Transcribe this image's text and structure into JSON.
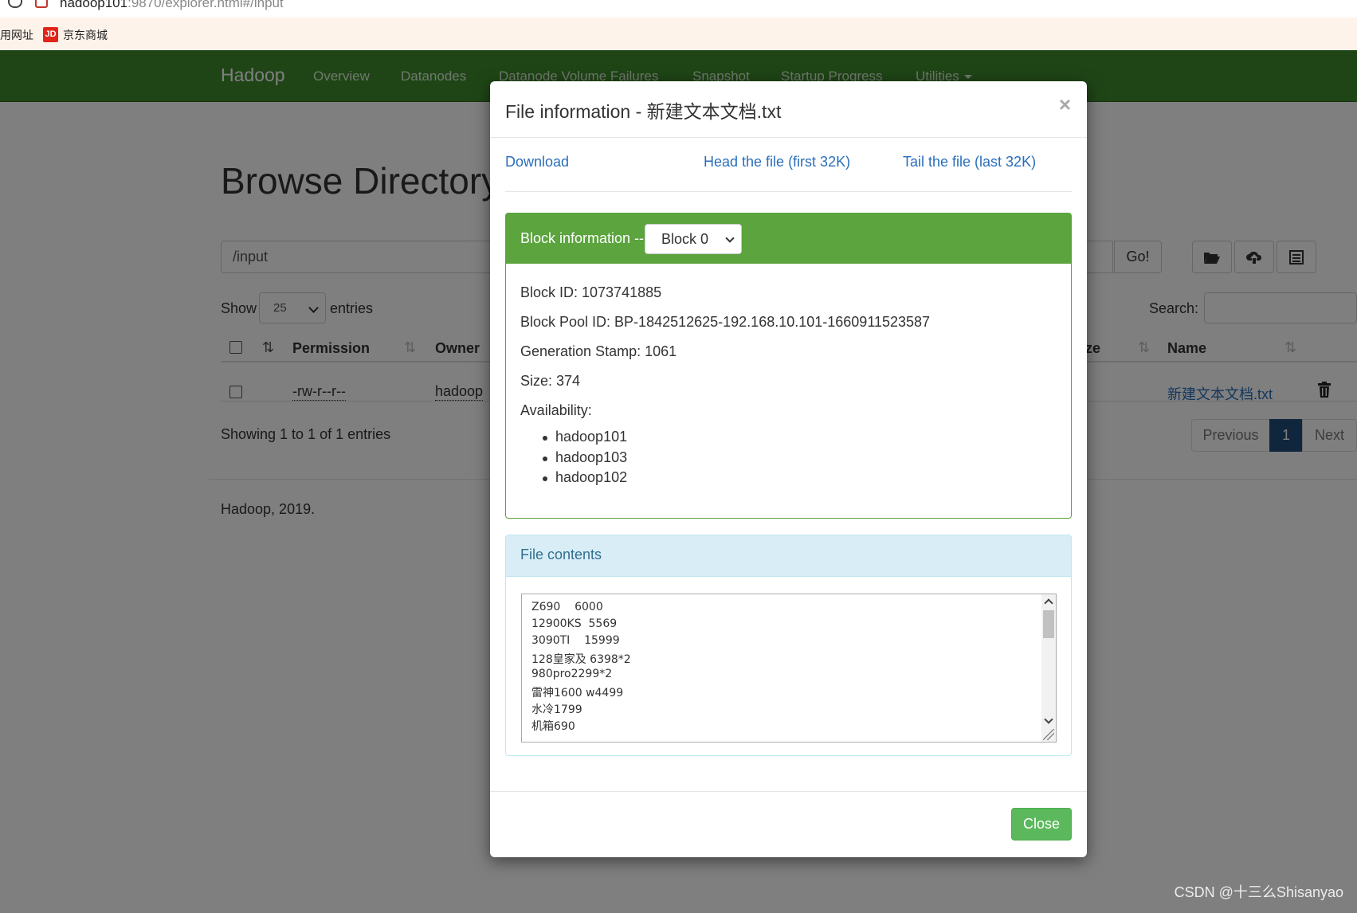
{
  "browser": {
    "url_host": "hadoop101",
    "url_rest": ":9870/explorer.html#/input",
    "bookmark_1": "用网址",
    "bookmark_2": "京东商城",
    "bookmark_2_logo": "JD"
  },
  "navbar": {
    "brand": "Hadoop",
    "items": [
      "Overview",
      "Datanodes",
      "Datanode Volume Failures",
      "Snapshot",
      "Startup Progress",
      "Utilities"
    ]
  },
  "page": {
    "title": "Browse Directory",
    "path_value": "/input",
    "go_label": "Go!",
    "show_label": "Show",
    "entries_select": "25",
    "entries_label": "entries",
    "search_label": "Search:",
    "columns": {
      "permission": "Permission",
      "owner": "Owner",
      "size_partial": "ze",
      "name": "Name"
    },
    "row": {
      "permission": "-rw-r--r--",
      "owner": "hadoop",
      "name": "新建文本文档.txt"
    },
    "showing": "Showing 1 to 1 of 1 entries",
    "pager": {
      "previous": "Previous",
      "current": "1",
      "next": "Next"
    },
    "footer": "Hadoop, 2019."
  },
  "modal": {
    "title": "File information - 新建文本文档.txt",
    "close_x": "×",
    "links": {
      "download": "Download",
      "head": "Head the file (first 32K)",
      "tail": "Tail the file (last 32K)"
    },
    "block": {
      "header": "Block information --",
      "selected": "Block 0",
      "block_id": "Block ID: 1073741885",
      "pool_id": "Block Pool ID: BP-1842512625-192.168.10.101-1660911523587",
      "gen_stamp": "Generation Stamp: 1061",
      "size": "Size: 374",
      "availability_label": "Availability:",
      "availability": [
        "hadoop101",
        "hadoop103",
        "hadoop102"
      ]
    },
    "contents": {
      "header": "File contents",
      "lines": [
        "Z690    6000",
        "12900KS  5569",
        "3090TI    15999",
        "128皇家及 6398*2",
        "980pro2299*2",
        "雷神1600 w4499",
        "水冷1799",
        "机箱690"
      ]
    },
    "close_button": "Close"
  },
  "watermark": "CSDN @十三么Shisanyao",
  "colors": {
    "navbar": "#3e8a2c",
    "block_header": "#5ba43e",
    "contents_header": "#d9edf7",
    "link": "#2a6ebb",
    "close_button": "#5cb85c"
  }
}
